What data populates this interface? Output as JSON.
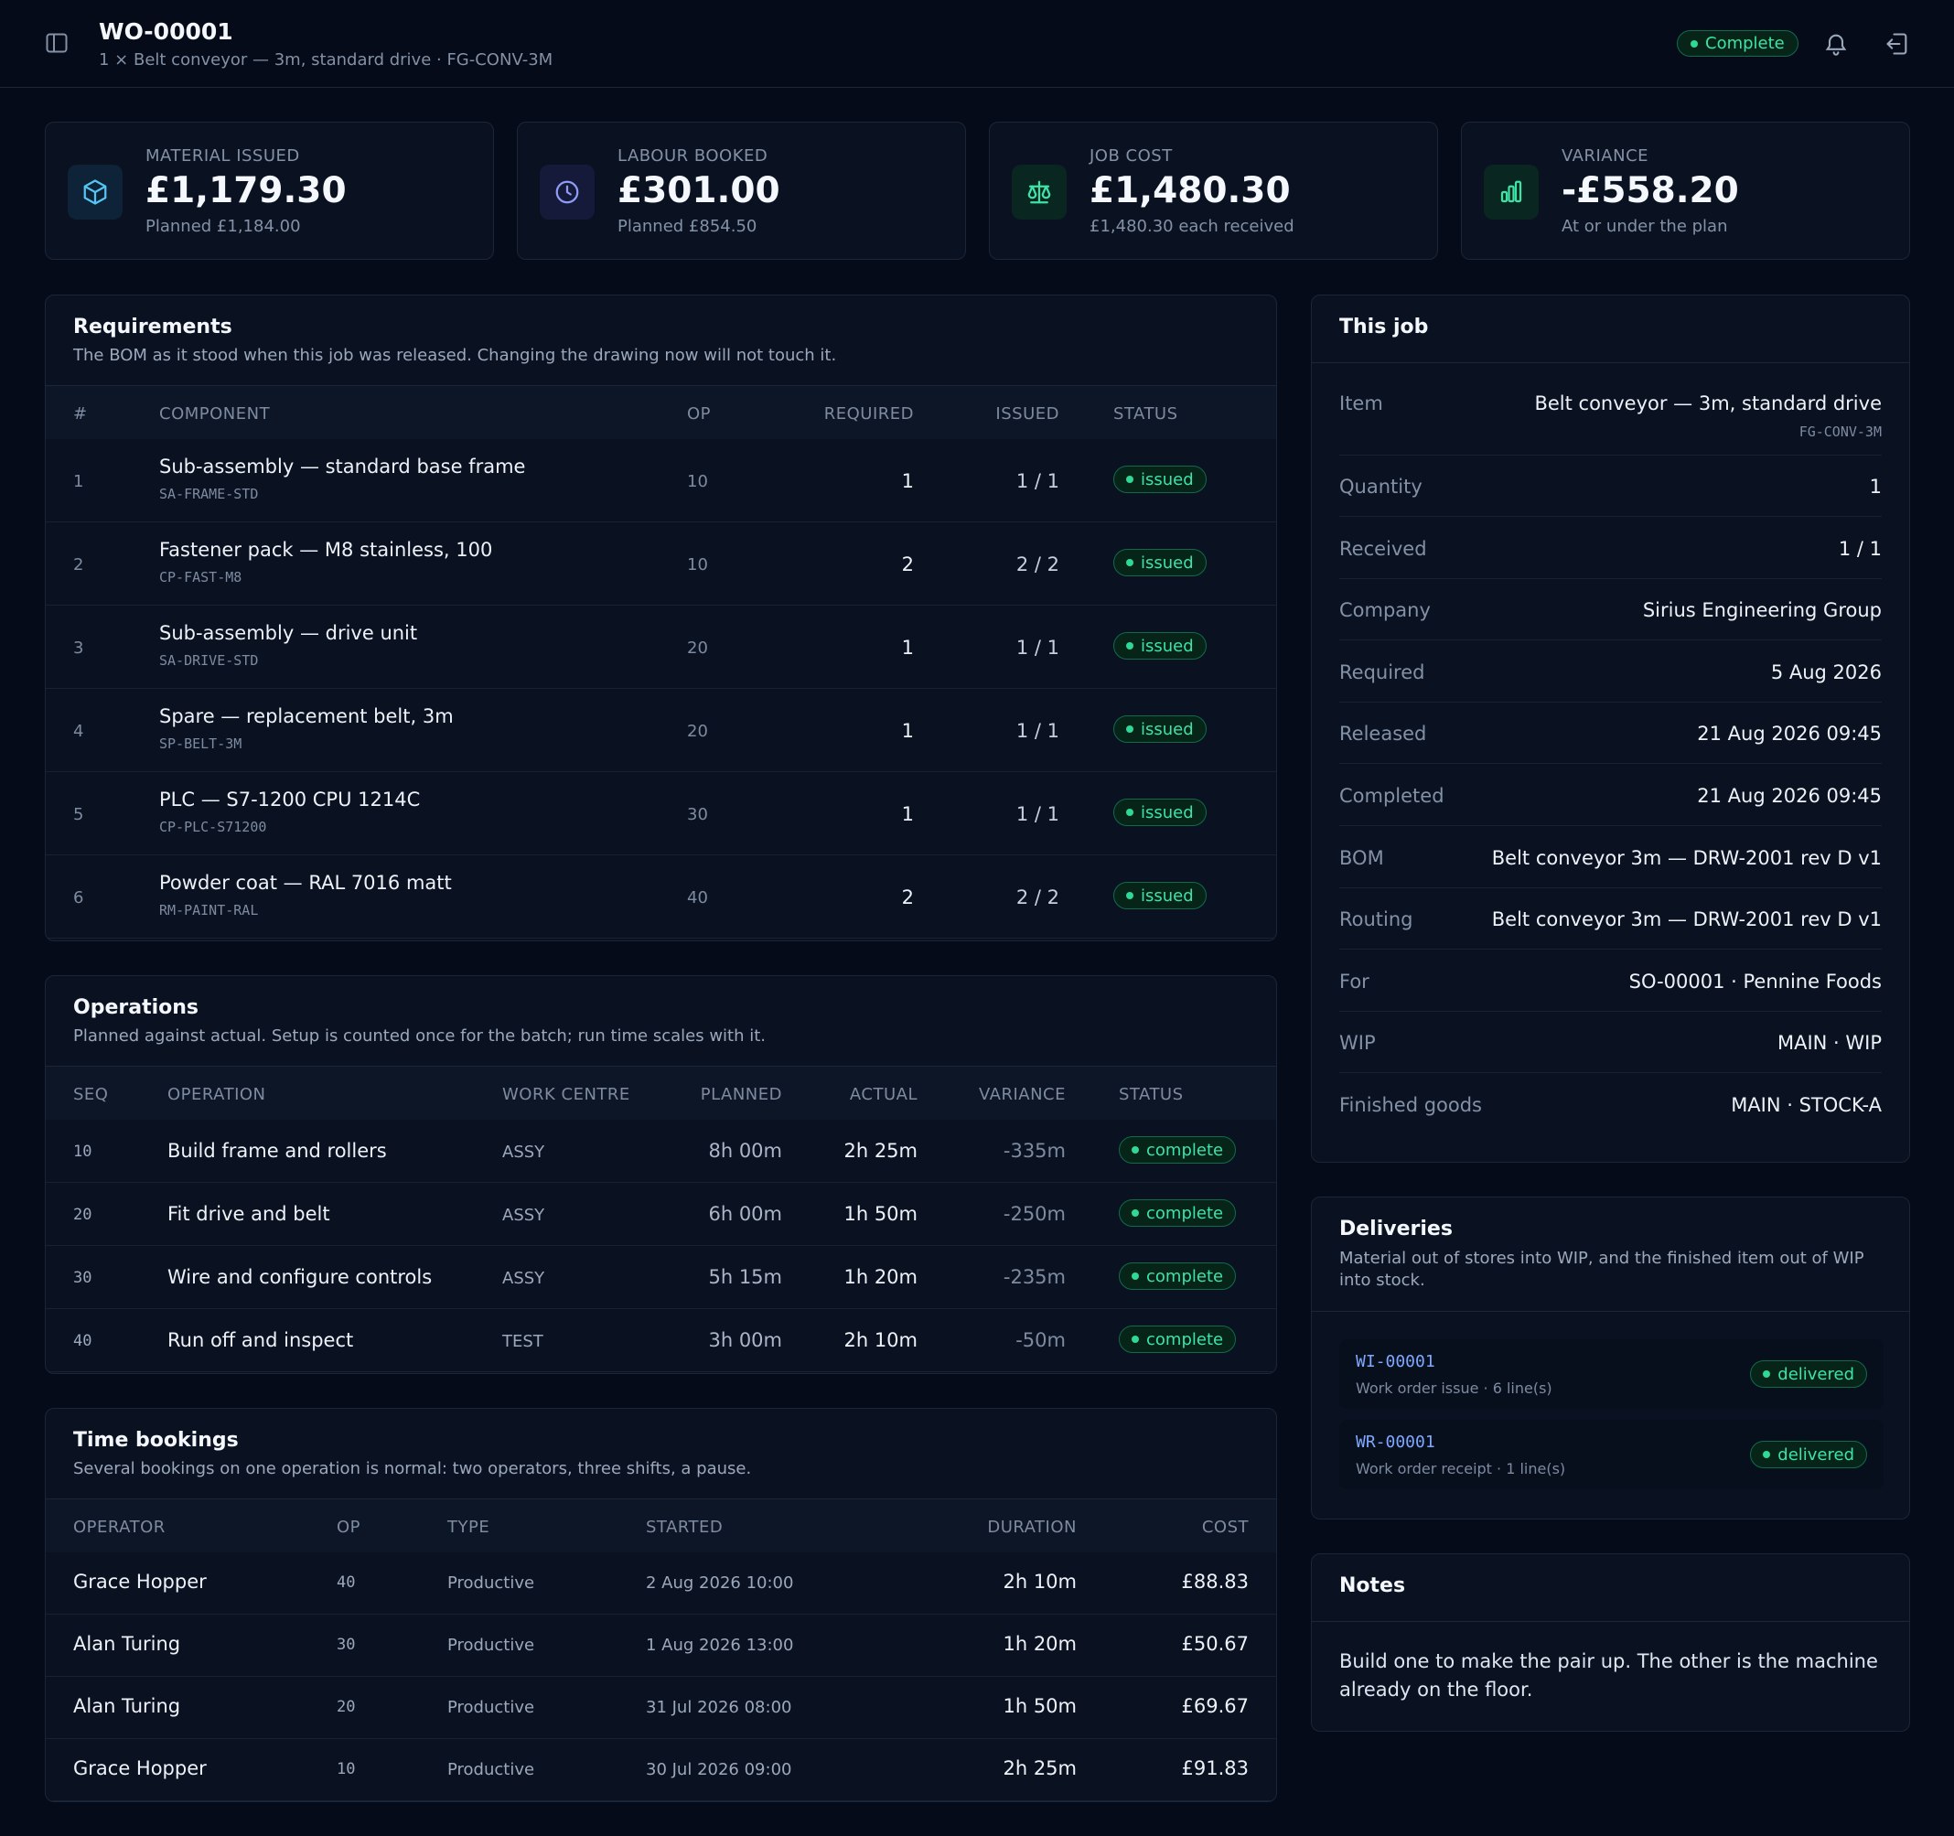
{
  "header": {
    "title": "WO-00001",
    "subtitle": "1 × Belt conveyor — 3m, standard drive · FG-CONV-3M",
    "status": "Complete",
    "icons": [
      "sidebar-toggle-icon",
      "bell-icon",
      "logout-icon"
    ]
  },
  "stats": [
    {
      "label": "MATERIAL ISSUED",
      "value": "£1,179.30",
      "sub": "Planned £1,184.00",
      "icon": "box-icon",
      "color": "#54c6f0"
    },
    {
      "label": "LABOUR BOOKED",
      "value": "£301.00",
      "sub": "Planned £854.50",
      "icon": "clock-icon",
      "color": "#8e9cf6"
    },
    {
      "label": "JOB COST",
      "value": "£1,480.30",
      "sub": "£1,480.30 each received",
      "icon": "scales-icon",
      "color": "#3ee3a6"
    },
    {
      "label": "VARIANCE",
      "value": "-£558.20",
      "sub": "At or under the plan",
      "icon": "bar-chart-icon",
      "color": "#3ee3a6"
    }
  ],
  "requirements": {
    "title": "Requirements",
    "desc": "The BOM as it stood when this job was released. Changing the drawing now will not touch it.",
    "headers": [
      "#",
      "COMPONENT",
      "OP",
      "REQUIRED",
      "ISSUED",
      "STATUS"
    ],
    "rows": [
      {
        "n": "1",
        "name": "Sub-assembly — standard base frame",
        "code": "SA-FRAME-STD",
        "op": "10",
        "req": "1",
        "issued": "1 / 1",
        "status": "issued"
      },
      {
        "n": "2",
        "name": "Fastener pack — M8 stainless, 100",
        "code": "CP-FAST-M8",
        "op": "10",
        "req": "2",
        "issued": "2 / 2",
        "status": "issued"
      },
      {
        "n": "3",
        "name": "Sub-assembly — drive unit",
        "code": "SA-DRIVE-STD",
        "op": "20",
        "req": "1",
        "issued": "1 / 1",
        "status": "issued"
      },
      {
        "n": "4",
        "name": "Spare — replacement belt, 3m",
        "code": "SP-BELT-3M",
        "op": "20",
        "req": "1",
        "issued": "1 / 1",
        "status": "issued"
      },
      {
        "n": "5",
        "name": "PLC — S7-1200 CPU 1214C",
        "code": "CP-PLC-S71200",
        "op": "30",
        "req": "1",
        "issued": "1 / 1",
        "status": "issued"
      },
      {
        "n": "6",
        "name": "Powder coat — RAL 7016 matt",
        "code": "RM-PAINT-RAL",
        "op": "40",
        "req": "2",
        "issued": "2 / 2",
        "status": "issued"
      }
    ]
  },
  "operations": {
    "title": "Operations",
    "desc": "Planned against actual. Setup is counted once for the batch; run time scales with it.",
    "headers": [
      "SEQ",
      "OPERATION",
      "WORK CENTRE",
      "PLANNED",
      "ACTUAL",
      "VARIANCE",
      "STATUS"
    ],
    "rows": [
      {
        "seq": "10",
        "op": "Build frame and rollers",
        "wc": "ASSY",
        "planned": "8h 00m",
        "actual": "2h 25m",
        "var": "-335m",
        "status": "complete"
      },
      {
        "seq": "20",
        "op": "Fit drive and belt",
        "wc": "ASSY",
        "planned": "6h 00m",
        "actual": "1h 50m",
        "var": "-250m",
        "status": "complete"
      },
      {
        "seq": "30",
        "op": "Wire and configure controls",
        "wc": "ASSY",
        "planned": "5h 15m",
        "actual": "1h 20m",
        "var": "-235m",
        "status": "complete"
      },
      {
        "seq": "40",
        "op": "Run off and inspect",
        "wc": "TEST",
        "planned": "3h 00m",
        "actual": "2h 10m",
        "var": "-50m",
        "status": "complete"
      }
    ]
  },
  "time": {
    "title": "Time bookings",
    "desc": "Several bookings on one operation is normal: two operators, three shifts, a pause.",
    "headers": [
      "OPERATOR",
      "OP",
      "TYPE",
      "STARTED",
      "DURATION",
      "COST"
    ],
    "rows": [
      {
        "who": "Grace Hopper",
        "op": "40",
        "type": "Productive",
        "started": "2 Aug 2026 10:00",
        "dur": "2h 10m",
        "cost": "£88.83"
      },
      {
        "who": "Alan Turing",
        "op": "30",
        "type": "Productive",
        "started": "1 Aug 2026 13:00",
        "dur": "1h 20m",
        "cost": "£50.67"
      },
      {
        "who": "Alan Turing",
        "op": "20",
        "type": "Productive",
        "started": "31 Jul 2026 08:00",
        "dur": "1h 50m",
        "cost": "£69.67"
      },
      {
        "who": "Grace Hopper",
        "op": "10",
        "type": "Productive",
        "started": "30 Jul 2026 09:00",
        "dur": "2h 25m",
        "cost": "£91.83"
      }
    ]
  },
  "job": {
    "title": "This job",
    "item_label": "Item",
    "item_value": "Belt conveyor — 3m, standard drive",
    "item_code": "FG-CONV-3M",
    "fields": [
      {
        "k": "Quantity",
        "v": "1"
      },
      {
        "k": "Received",
        "v": "1 / 1"
      },
      {
        "k": "Company",
        "v": "Sirius Engineering Group"
      },
      {
        "k": "Required",
        "v": "5 Aug 2026"
      },
      {
        "k": "Released",
        "v": "21 Aug 2026 09:45"
      },
      {
        "k": "Completed",
        "v": "21 Aug 2026 09:45"
      },
      {
        "k": "BOM",
        "v": "Belt conveyor 3m — DRW-2001 rev D v1"
      },
      {
        "k": "Routing",
        "v": "Belt conveyor 3m — DRW-2001 rev D v1"
      },
      {
        "k": "For",
        "v": "SO-00001 · Pennine Foods",
        "link": true
      },
      {
        "k": "WIP",
        "v": "MAIN · WIP"
      },
      {
        "k": "Finished goods",
        "v": "MAIN · STOCK-A"
      }
    ]
  },
  "deliveries": {
    "title": "Deliveries",
    "desc": "Material out of stores into WIP, and the finished item out of WIP into stock.",
    "items": [
      {
        "id": "WI-00001",
        "sub": "Work order issue · 6 line(s)",
        "status": "delivered"
      },
      {
        "id": "WR-00001",
        "sub": "Work order receipt · 1 line(s)",
        "status": "delivered"
      }
    ]
  },
  "notes": {
    "title": "Notes",
    "text": "Build one to make the pair up. The other is the machine already on the floor."
  }
}
